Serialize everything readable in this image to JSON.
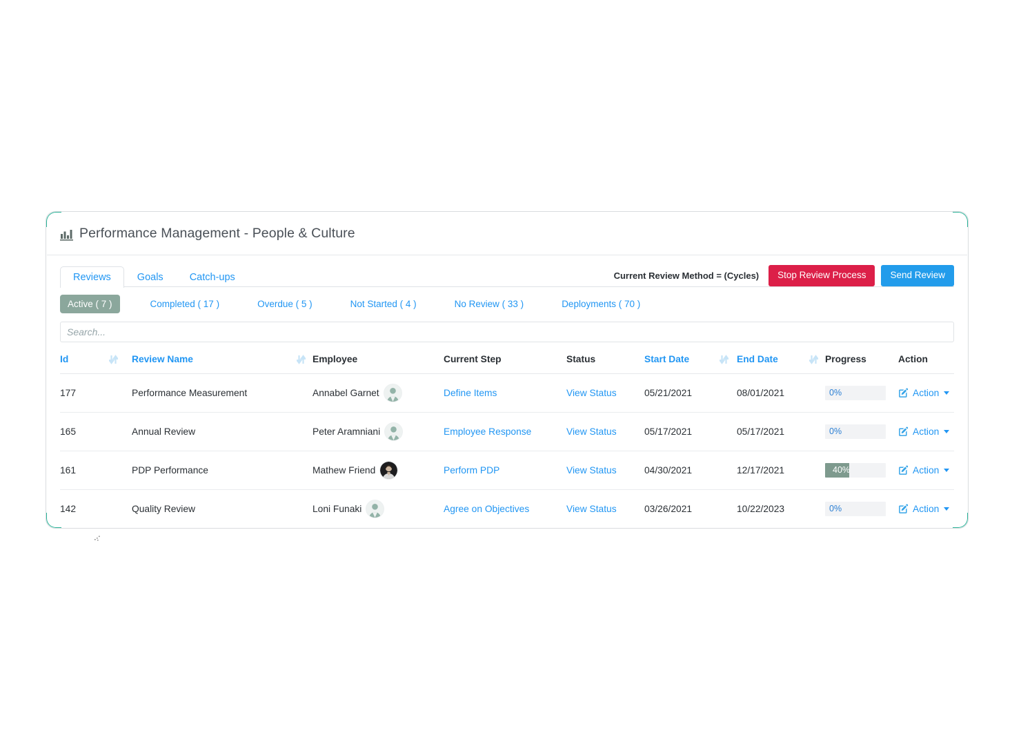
{
  "header": {
    "icon": "bar-chart-icon",
    "title": "Performance Management - People & Culture"
  },
  "tabs": [
    {
      "label": "Reviews",
      "active": true
    },
    {
      "label": "Goals",
      "active": false
    },
    {
      "label": "Catch-ups",
      "active": false
    }
  ],
  "header_actions": {
    "review_method_label": "Current Review Method = (Cycles)",
    "stop_button": "Stop Review Process",
    "send_button": "Send Review",
    "stop_color": "#dc1f48",
    "send_color": "#229ceb"
  },
  "filters": [
    {
      "label": "Active ( 7 )",
      "active": true
    },
    {
      "label": "Completed ( 17 )",
      "active": false
    },
    {
      "label": "Overdue ( 5 )",
      "active": false
    },
    {
      "label": "Not Started ( 4 )",
      "active": false
    },
    {
      "label": "No Review ( 33 )",
      "active": false
    },
    {
      "label": "Deployments ( 70 )",
      "active": false
    }
  ],
  "search": {
    "placeholder": "Search...",
    "value": ""
  },
  "table": {
    "columns": {
      "id": "Id",
      "review_name": "Review Name",
      "employee": "Employee",
      "current_step": "Current Step",
      "status": "Status",
      "start_date": "Start Date",
      "end_date": "End Date",
      "progress": "Progress",
      "action": "Action"
    },
    "rows": [
      {
        "id": "177",
        "review_name": "Performance Measurement",
        "employee": "Annabel Garnet",
        "avatar": "generic-female-avatar",
        "current_step": "Define Items",
        "status": "View Status",
        "start_date": "05/21/2021",
        "end_date": "08/01/2021",
        "progress_text": "0%",
        "progress_value": 0,
        "action": "Action"
      },
      {
        "id": "165",
        "review_name": "Annual Review",
        "employee": "Peter Aramniani",
        "avatar": "generic-male-avatar",
        "current_step": "Employee Response",
        "status": "View Status",
        "start_date": "05/17/2021",
        "end_date": "05/17/2021",
        "progress_text": "0%",
        "progress_value": 0,
        "action": "Action"
      },
      {
        "id": "161",
        "review_name": "PDP Performance",
        "employee": "Mathew Friend",
        "avatar": "photo-avatar",
        "current_step": "Perform PDP",
        "status": "View Status",
        "start_date": "04/30/2021",
        "end_date": "12/17/2021",
        "progress_text": "40%",
        "progress_value": 40,
        "action": "Action"
      },
      {
        "id": "142",
        "review_name": "Quality Review",
        "employee": "Loni Funaki",
        "avatar": "generic-female-avatar",
        "current_step": "Agree on Objectives",
        "status": "View Status",
        "start_date": "03/26/2021",
        "end_date": "10/22/2023",
        "progress_text": "0%",
        "progress_value": 0,
        "action": "Action"
      }
    ]
  },
  "theme": {
    "accent_teal": "#2bb398",
    "link_blue": "#2196f3",
    "pill_active_bg": "#8ba79c",
    "progress_fill": "#7e9a8e"
  }
}
